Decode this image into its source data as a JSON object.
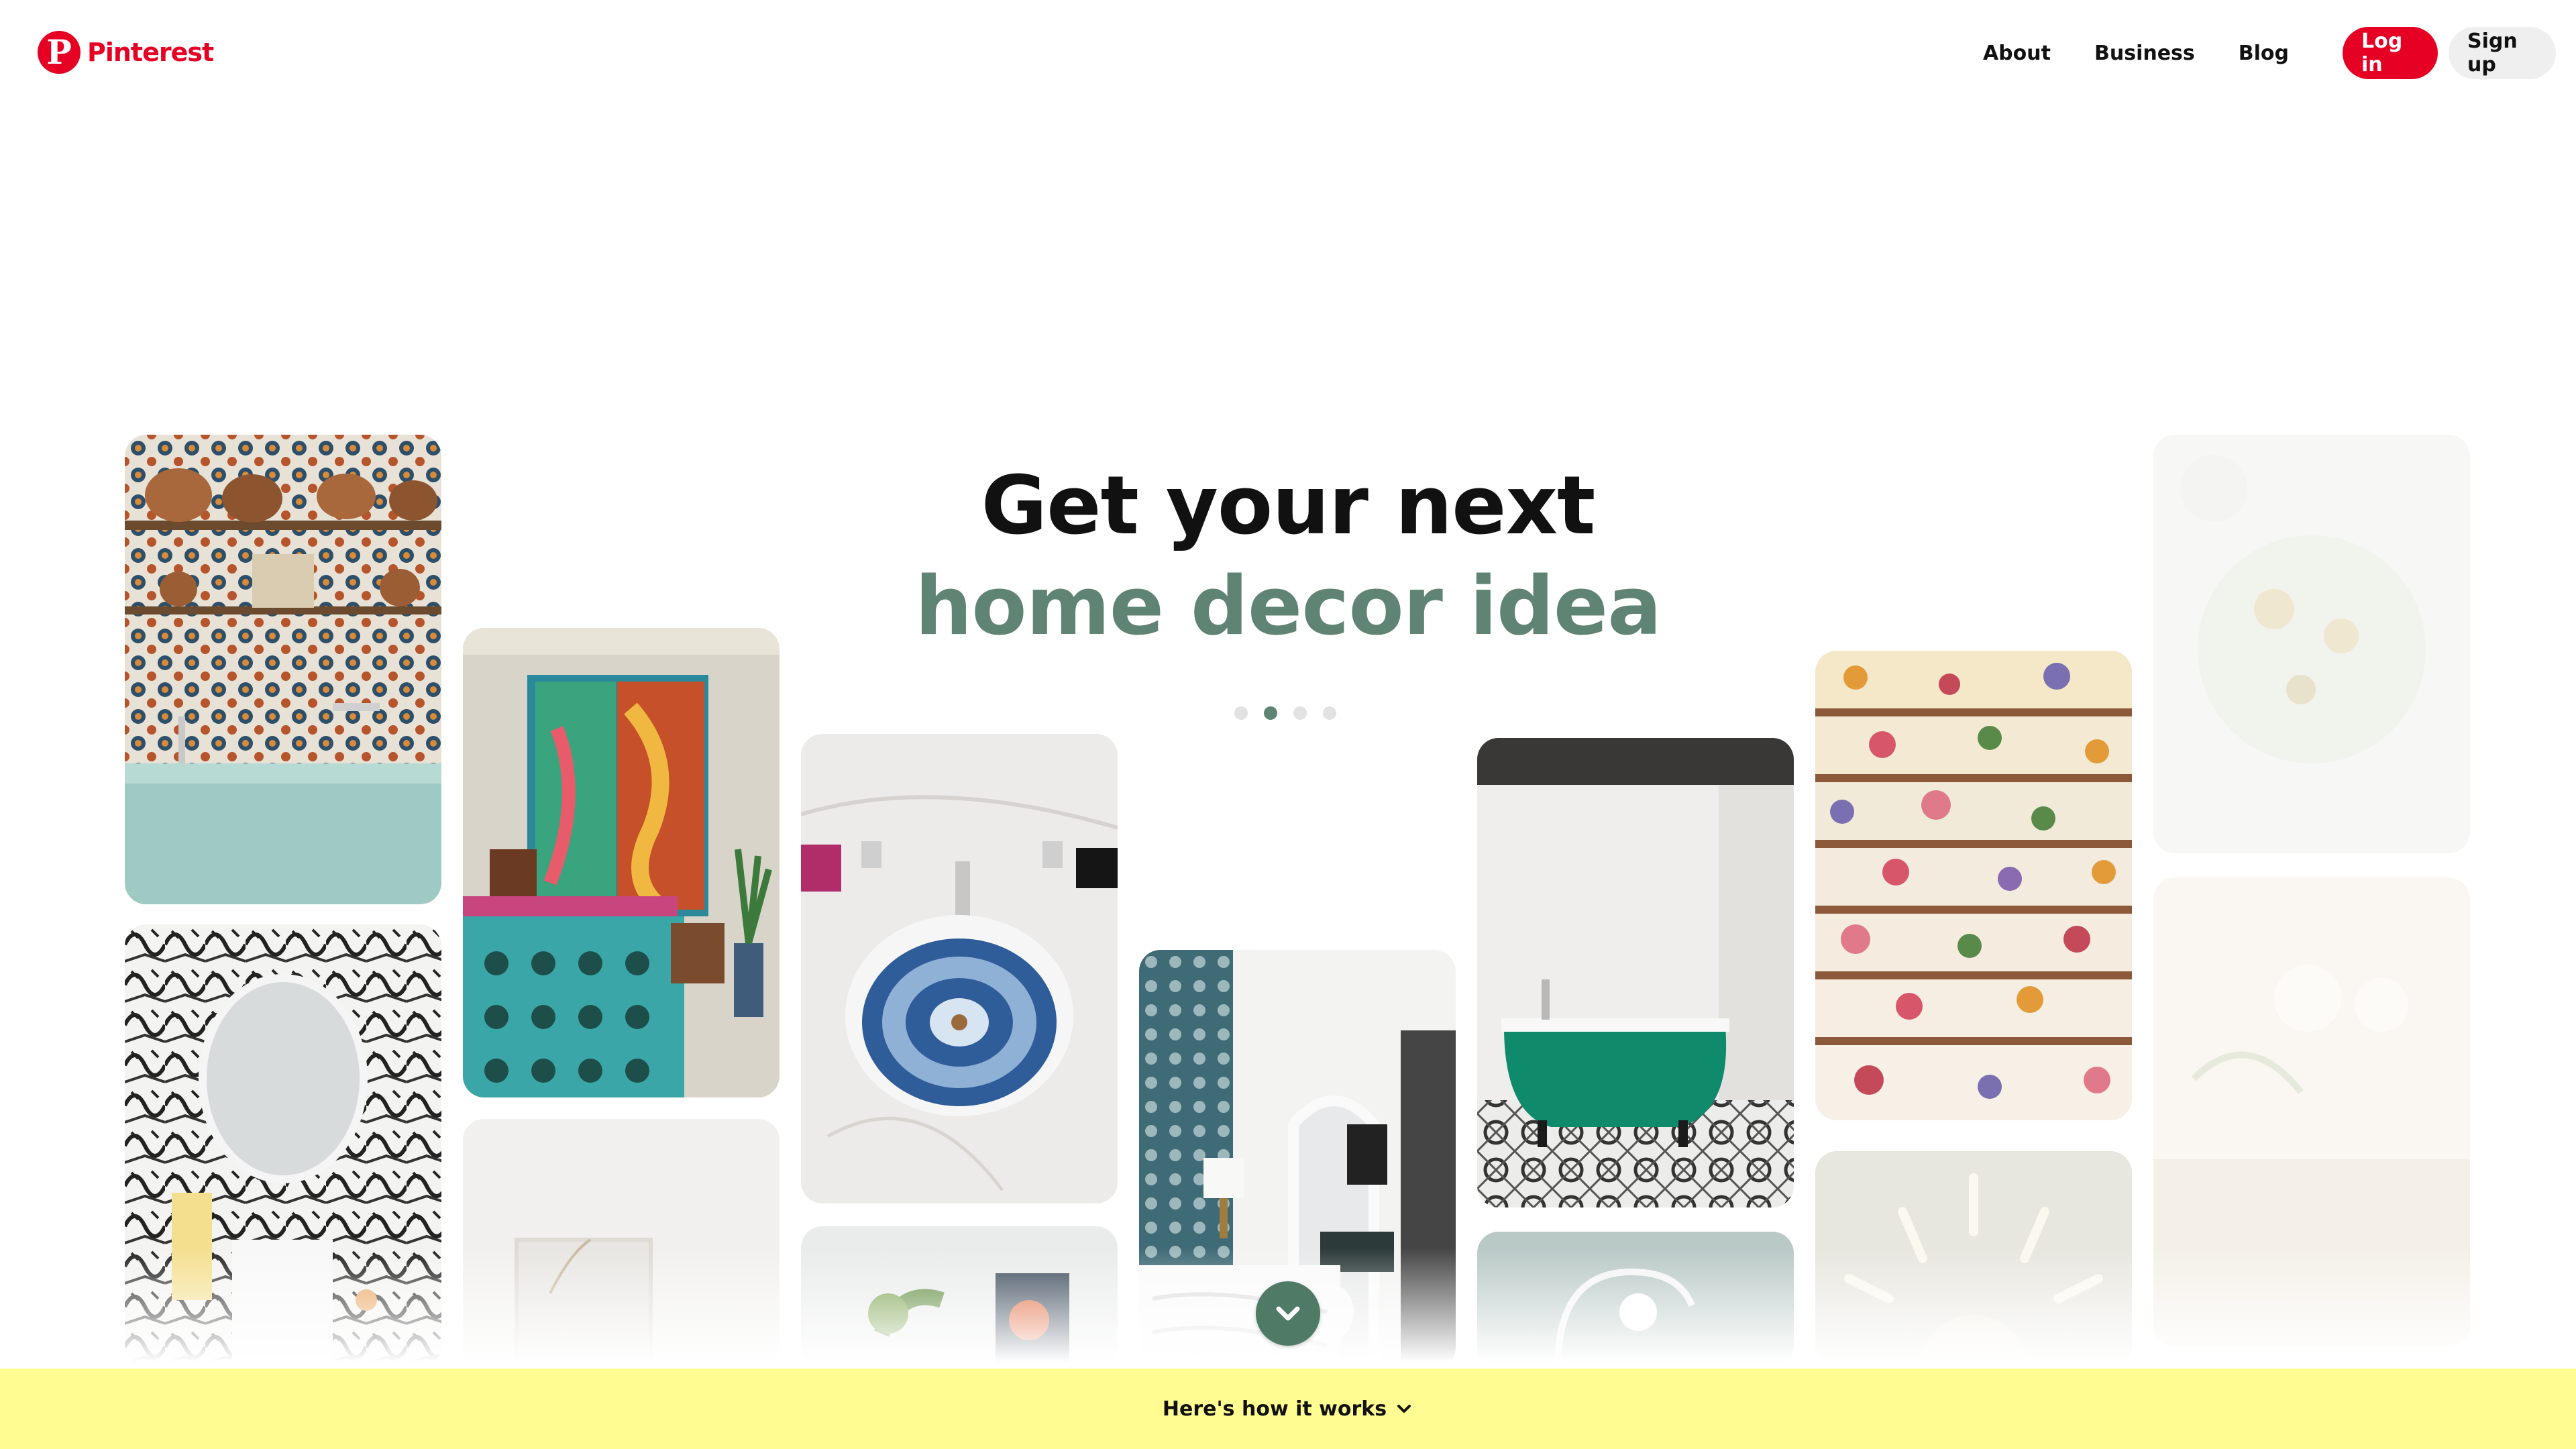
{
  "header": {
    "logo_text": "Pinterest",
    "logo_glyph": "P",
    "nav": [
      "About",
      "Business",
      "Blog"
    ],
    "login_label": "Log in",
    "signup_label": "Sign up"
  },
  "hero": {
    "line1": "Get your next",
    "line2": "home decor idea",
    "accent_color": "#5f8473",
    "active_dot": 1,
    "dot_count": 4
  },
  "banner": {
    "label": "Here's how it works",
    "color": "#fffd92"
  },
  "colors": {
    "brand": "#e60023",
    "scroll_button": "#4e7a66"
  }
}
